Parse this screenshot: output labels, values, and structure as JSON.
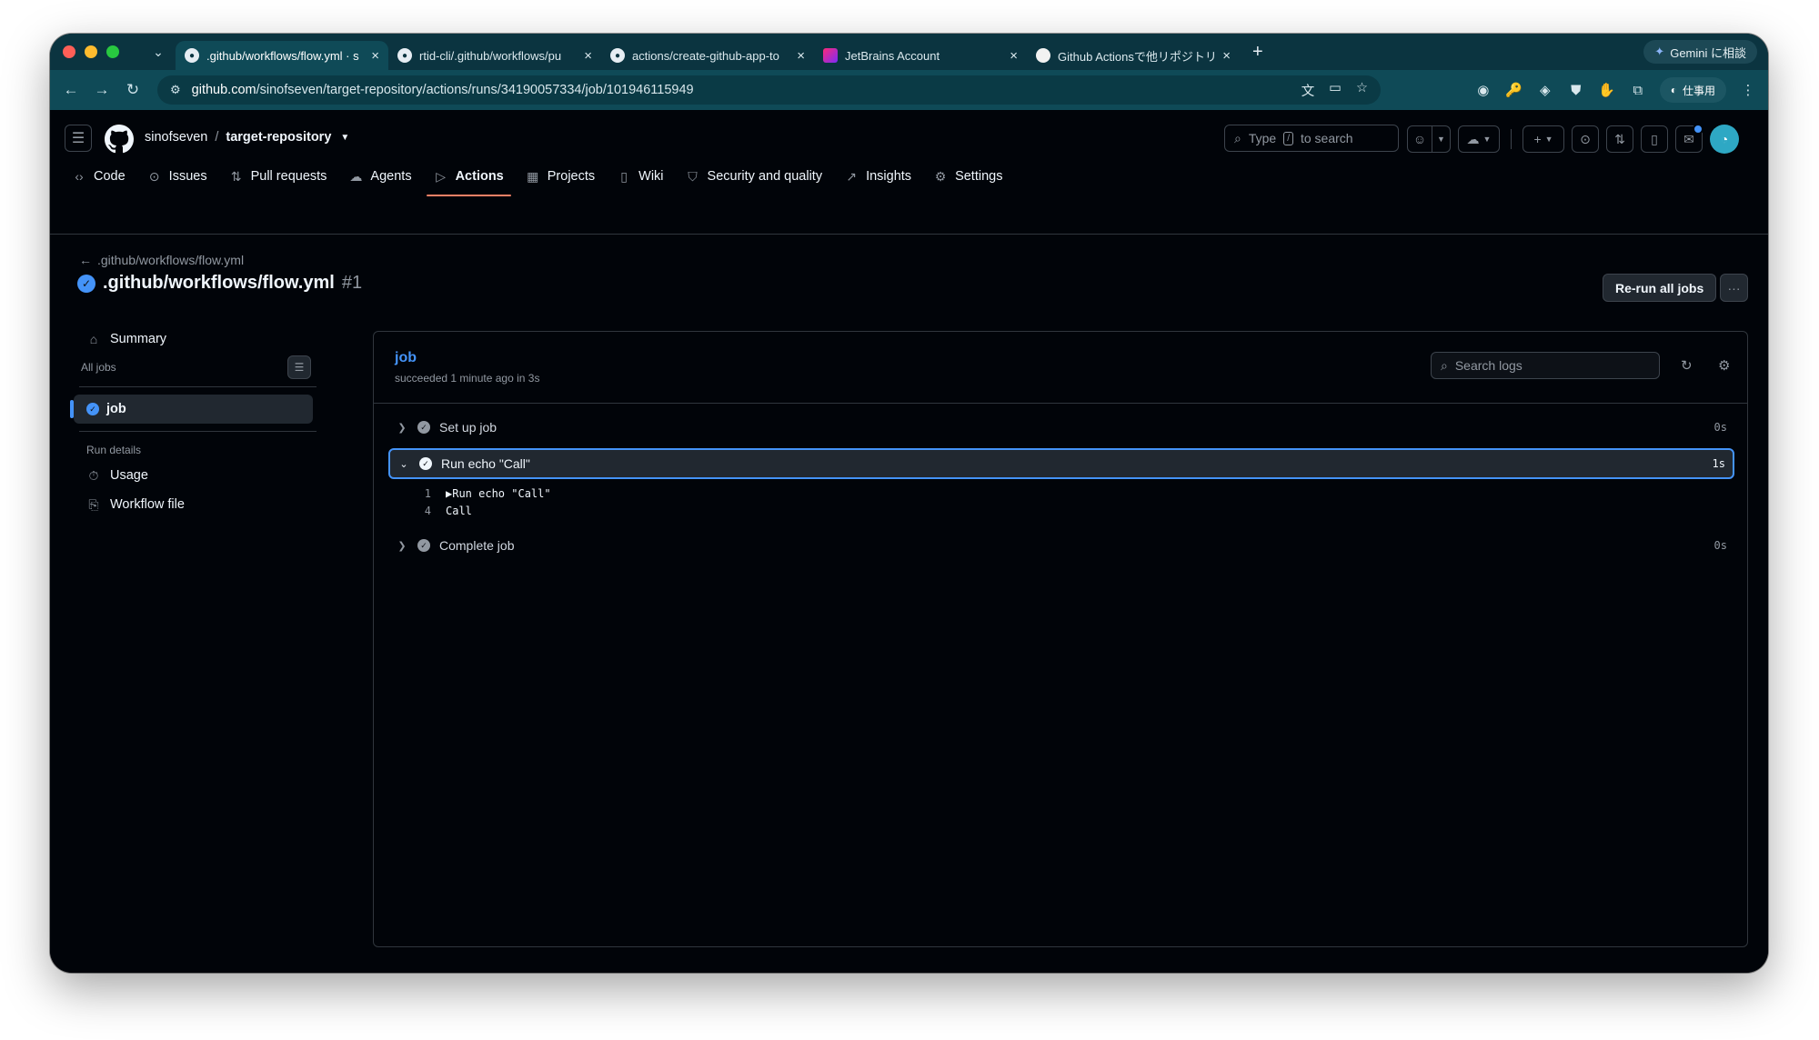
{
  "browser": {
    "tabs": [
      {
        "title": ".github/workflows/flow.yml · s",
        "active": true,
        "favicon": "github-icon"
      },
      {
        "title": "rtid-cli/.github/workflows/pu",
        "active": false,
        "favicon": "github-icon"
      },
      {
        "title": "actions/create-github-app-to",
        "active": false,
        "favicon": "github-icon"
      },
      {
        "title": "JetBrains Account",
        "active": false,
        "favicon": "jetbrains-icon"
      },
      {
        "title": "Github Actionsで他リポジトリ",
        "active": false,
        "favicon": "globe-icon"
      }
    ],
    "gemini_label": "Gemini に相談",
    "url_host": "github.com",
    "url_path": "/sinofseven/target-repository/actions/runs/34190057334/job/101946115949",
    "profile_label": "仕事用"
  },
  "header": {
    "owner": "sinofseven",
    "separator": "/",
    "repo": "target-repository",
    "search_prefix": "Type",
    "search_key": "/",
    "search_suffix": "to search"
  },
  "repo_nav": [
    {
      "label": "Code",
      "icon": "code-icon",
      "glyph": "‹›"
    },
    {
      "label": "Issues",
      "icon": "issue-icon",
      "glyph": "⊙"
    },
    {
      "label": "Pull requests",
      "icon": "pull-request-icon",
      "glyph": "⇅"
    },
    {
      "label": "Agents",
      "icon": "agents-icon",
      "glyph": "☁"
    },
    {
      "label": "Actions",
      "icon": "play-icon",
      "glyph": "▷",
      "active": true
    },
    {
      "label": "Projects",
      "icon": "table-icon",
      "glyph": "▦"
    },
    {
      "label": "Wiki",
      "icon": "book-icon",
      "glyph": "▯"
    },
    {
      "label": "Security and quality",
      "icon": "shield-icon",
      "glyph": "⛉"
    },
    {
      "label": "Insights",
      "icon": "graph-icon",
      "glyph": "↗"
    },
    {
      "label": "Settings",
      "icon": "gear-icon",
      "glyph": "⚙"
    }
  ],
  "run": {
    "back_label": ".github/workflows/flow.yml",
    "title": ".github/workflows/flow.yml",
    "number": "#1",
    "rerun_label": "Re-run all jobs"
  },
  "sidebar": {
    "summary_label": "Summary",
    "all_jobs_label": "All jobs",
    "job_label": "job",
    "run_details_label": "Run details",
    "usage_label": "Usage",
    "workflow_file_label": "Workflow file"
  },
  "job": {
    "title": "job",
    "status": "succeeded 1 minute ago in 3s",
    "search_placeholder": "Search logs",
    "steps": [
      {
        "name": "Set up job",
        "duration": "0s",
        "expanded": false
      },
      {
        "name": "Run echo \"Call\"",
        "duration": "1s",
        "expanded": true
      },
      {
        "name": "Complete job",
        "duration": "0s",
        "expanded": false
      }
    ],
    "log_lines": [
      {
        "num": "1",
        "text": "▶Run echo \"Call\""
      },
      {
        "num": "4",
        "text": "Call"
      }
    ]
  },
  "colors": {
    "accent_blue": "#4493f8",
    "tab_underline": "#f78166",
    "page_bg": "#010409",
    "browser_frame": "#0f4a57"
  }
}
